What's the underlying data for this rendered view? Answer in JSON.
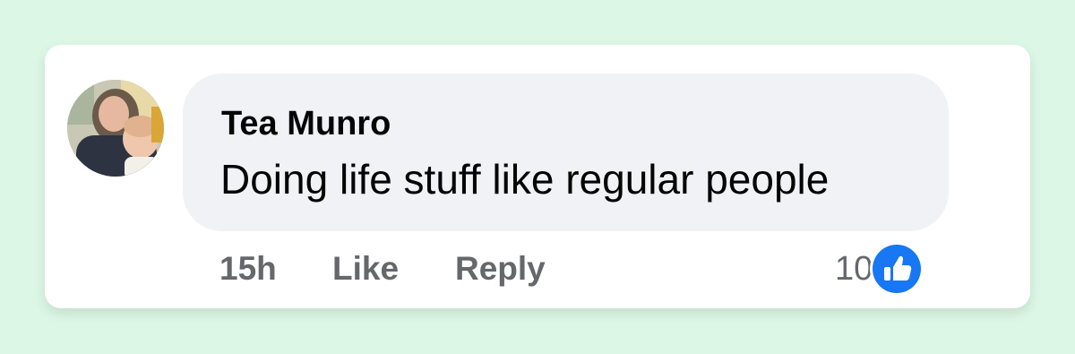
{
  "comment": {
    "author": "Tea Munro",
    "text": "Doing life stuff like regular people",
    "timestamp": "15h",
    "like_label": "Like",
    "reply_label": "Reply",
    "reaction_count": "10",
    "reaction_type": "like-icon"
  },
  "colors": {
    "background": "#dcf7e6",
    "bubble": "#f0f2f5",
    "meta_text": "#65676b",
    "like_blue": "#1877f2"
  }
}
